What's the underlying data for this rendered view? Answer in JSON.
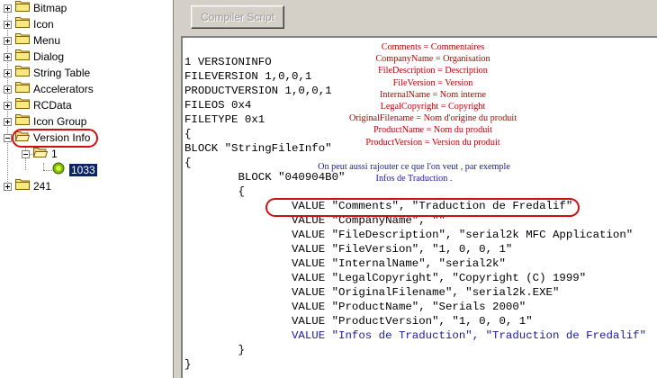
{
  "tree": {
    "items": [
      {
        "label": "Bitmap"
      },
      {
        "label": "Icon"
      },
      {
        "label": "Menu"
      },
      {
        "label": "Dialog"
      },
      {
        "label": "String Table"
      },
      {
        "label": "Accelerators"
      },
      {
        "label": "RCData"
      },
      {
        "label": "Icon Group"
      },
      {
        "label": "Version Info"
      },
      {
        "label": "1"
      },
      {
        "label": "1033"
      },
      {
        "label": "241"
      }
    ]
  },
  "toolbar": {
    "compile_label": "Compiler Script"
  },
  "script": {
    "lines": [
      "1 VERSIONINFO",
      "FILEVERSION 1,0,0,1",
      "PRODUCTVERSION 1,0,0,1",
      "FILEOS 0x4",
      "FILETYPE 0x1",
      "{",
      "BLOCK \"StringFileInfo\"",
      "{",
      "        BLOCK \"040904B0\"",
      "        {",
      "                VALUE \"Comments\", \"Traduction de Fredalif\"",
      "                VALUE \"CompanyName\", \"\"",
      "                VALUE \"FileDescription\", \"serial2k MFC Application\"",
      "                VALUE \"FileVersion\", \"1, 0, 0, 1\"",
      "                VALUE \"InternalName\", \"serial2k\"",
      "                VALUE \"LegalCopyright\", \"Copyright (C) 1999\"",
      "                VALUE \"OriginalFilename\", \"serial2k.EXE\"",
      "                VALUE \"ProductName\", \"Serials 2000\"",
      "                VALUE \"ProductVersion\", \"1, 0, 0, 1\"",
      "                VALUE \"Infos de Traduction\", \"Traduction de Fredalif\"",
      "        }",
      "}"
    ]
  },
  "notes": {
    "translations": [
      "Comments = Commentaires",
      "CompanyName = Organisation",
      "FileDescription = Description",
      "FileVersion = Version",
      "InternalName = Nom interne",
      "LegalCopyright = Copyright",
      "OriginalFilename = Nom d'origine du produit",
      "ProductName = Nom du produit",
      "ProductVersion = Version du produit"
    ],
    "tip_line1": "On peut aussi rajouter ce que l'on veut , par exemple",
    "tip_line2": "Infos de Traduction ."
  },
  "colors": {
    "annotation_red": "#c00000",
    "annotation_blue": "#1a1aa0",
    "highlight_ring": "#d01010",
    "selection": "#0a246a"
  }
}
